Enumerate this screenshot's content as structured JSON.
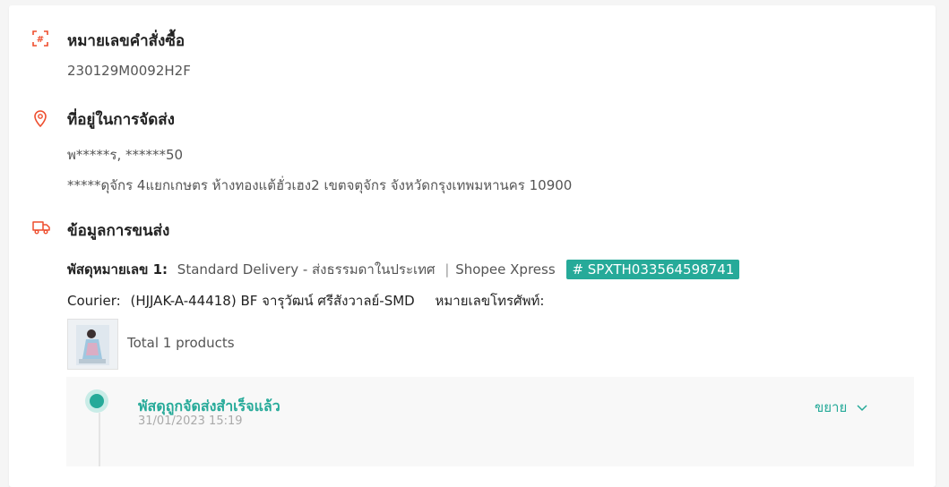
{
  "order": {
    "title": "หมายเลขคำสั่งซื้อ",
    "number": "230129M0092H2F",
    "icon": "hash-icon"
  },
  "address": {
    "title": "ที่อยู่ในการจัดส่ง",
    "name_phone": "พ*****ร, ******50",
    "line": "*****ดุจักร 4แยกเกษตร ห้างทองแต้ฮั่วเฮง2 เขตจตุจักร จังหวัดกรุงเทพมหานคร 10900",
    "icon": "location-pin-icon"
  },
  "shipping": {
    "title": "ข้อมูลการขนส่ง",
    "parcel_label": "พัสดุหมายเลข 1:",
    "delivery_type": "Standard Delivery - ส่งธรรมดาในประเทศ",
    "separator": "|",
    "carrier": "Shopee Xpress",
    "tracking_tag": "# SPXTH033564598741",
    "courier_label": "Courier:",
    "courier_value": "(HJJAK-A-44418) BF จารุวัฒน์ ศรีสังวาลย์-SMD",
    "phone_label": "หมายเลขโทรศัพท์:",
    "products_total": "Total 1 products",
    "icon": "truck-icon"
  },
  "tracking": {
    "status": "พัสดุถูกจัดส่งสำเร็จแล้ว",
    "time": "31/01/2023 15:19",
    "expand_label": "ขยาย"
  },
  "colors": {
    "accent": "#26aa99",
    "icon": "#ee4d2d"
  }
}
